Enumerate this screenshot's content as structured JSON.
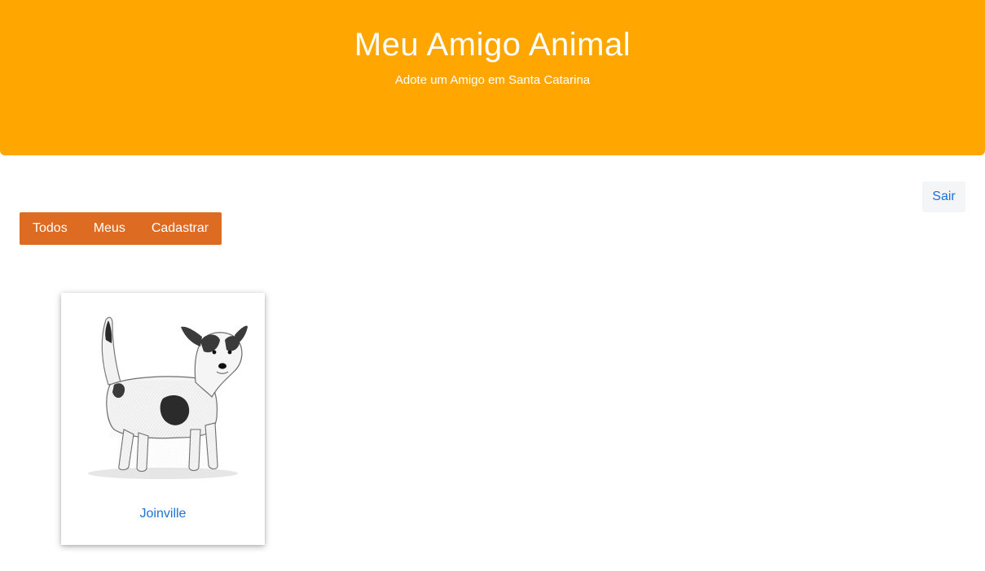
{
  "header": {
    "title": "Meu Amigo Animal",
    "subtitle": "Adote um Amigo em Santa Catarina"
  },
  "actions": {
    "logout_label": "Sair"
  },
  "nav": {
    "tabs": [
      {
        "label": "Todos"
      },
      {
        "label": "Meus"
      },
      {
        "label": "Cadastrar"
      }
    ]
  },
  "animals": [
    {
      "city": "Joinville",
      "image": "dog-sketch"
    }
  ],
  "colors": {
    "hero": "#ffa700",
    "tabbar": "#dd6b22",
    "link": "#1a73d9"
  }
}
